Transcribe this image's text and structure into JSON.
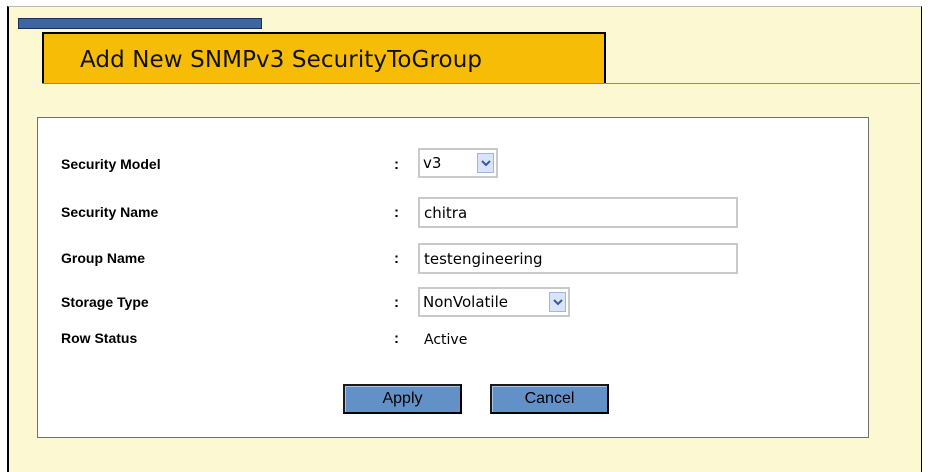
{
  "page": {
    "title": "Add New SNMPv3 SecurityToGroup"
  },
  "colors": {
    "background": "#fcf9d2",
    "title_tab": "#f7bd06",
    "title_strip": "#3f64a3",
    "button": "#6390c6"
  },
  "form": {
    "security_model": {
      "label": "Security Model",
      "separator": ":",
      "value": "v3"
    },
    "security_name": {
      "label": "Security Name",
      "separator": ":",
      "value": "chitra"
    },
    "group_name": {
      "label": "Group Name",
      "separator": ":",
      "value": "testengineering"
    },
    "storage_type": {
      "label": "Storage Type",
      "separator": ":",
      "value": "NonVolatile"
    },
    "row_status": {
      "label": "Row Status",
      "separator": ":",
      "value": "Active"
    }
  },
  "buttons": {
    "apply": "Apply",
    "cancel": "Cancel"
  },
  "icons": {
    "dropdown": "chevron-down-icon"
  }
}
